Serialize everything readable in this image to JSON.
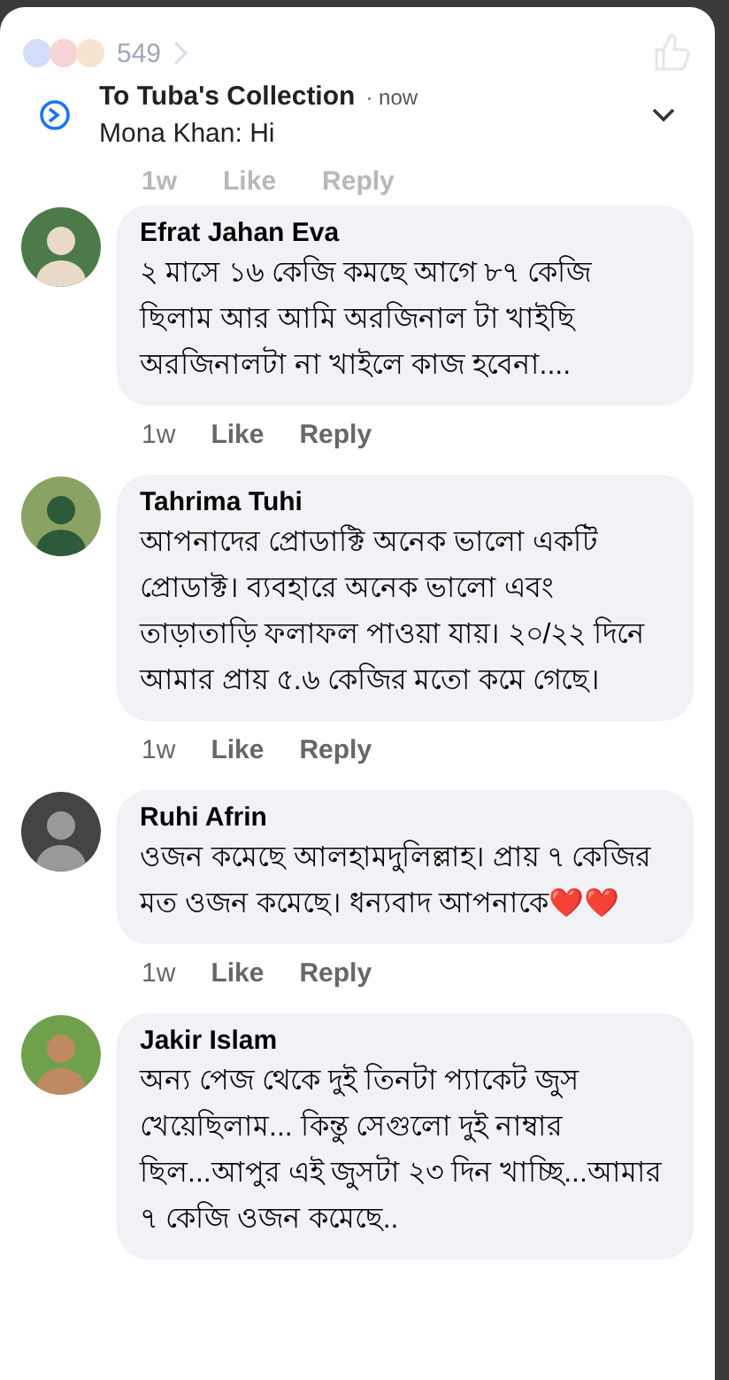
{
  "background": {
    "reaction_count": "549",
    "meta": {
      "time": "1w",
      "like": "Like",
      "reply": "Reply"
    }
  },
  "notification": {
    "title": "To Tuba's Collection",
    "separator": "·",
    "time": "now",
    "sender": "Mona Khan:",
    "message": "Hi"
  },
  "comments": [
    {
      "author": "Efrat Jahan Eva",
      "text": "২ মাসে ১৬ কেজি কমছে আগে ৮৭ কেজি ছিলাম আর আমি অরজিনাল টা খাইছি অরজিনালটা না খাইলে কাজ হবেনা....",
      "time": "1w",
      "like": "Like",
      "reply": "Reply"
    },
    {
      "author": "Tahrima Tuhi",
      "text": "আপনাদের প্রোডাক্টি অনেক ভালো একটি প্রোডাক্ট। ব্যবহারে অনেক ভালো এবং তাড়াতাড়ি ফলাফল পাওয়া যায়। ২০/২২ দিনে আমার প্রায় ৫.৬ কেজির মতো কমে গেছে।",
      "time": "1w",
      "like": "Like",
      "reply": "Reply"
    },
    {
      "author": "Ruhi Afrin",
      "text": "ওজন কমেছে আলহামদুলিল্লাহ। প্রায় ৭ কেজির মত ওজন কমেছে। ধন্যবাদ আপনাকে❤️❤️",
      "time": "1w",
      "like": "Like",
      "reply": "Reply"
    },
    {
      "author": "Jakir Islam",
      "text": "অন্য পেজ থেকে দুই তিনটা প্যাকেট জুস খেয়েছিলাম... কিন্তু সেগুলো দুই নাম্বার ছিল...আপুর এই জুসটা ২৩ দিন খাচ্ছি...আমার ৭ কেজি ওজন কমেছে.."
    }
  ]
}
